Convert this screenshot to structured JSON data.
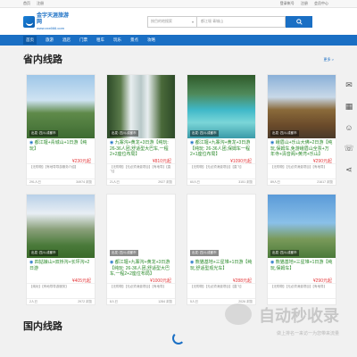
{
  "topbar": {
    "left": [
      "首页",
      "注册"
    ],
    "right": [
      "登录帐号",
      "注册",
      "会员中心"
    ]
  },
  "logo": {
    "title": "金字天涯旅游网",
    "sub": "www.xxx666.com"
  },
  "search": {
    "select": "按目的地搜索",
    "placeholder": "都江堰 青城山",
    "button_icon": "search-icon"
  },
  "nav": [
    "首页",
    "旅游",
    "酒店",
    "门票",
    "租车",
    "玩乐",
    "景点",
    "攻略"
  ],
  "section1": {
    "title": "省内线路",
    "more": "更多 >"
  },
  "section2": {
    "title": "国内线路"
  },
  "cards": [
    {
      "tag": "出发: 四川-成都市",
      "title": "都江堰+青城山+1日游【纯玩】",
      "price": "¥230元起",
      "desc": "【无购物】【有地导导游服务介绍】",
      "foot_left": "291人已",
      "foot_right": "34974 浏览",
      "img": "pagoda"
    },
    {
      "tag": "出发: 四川-成都市",
      "title": "九寨沟+黄龙+3日游【纯玩: 26-36人团,舒适型大巴车,一程2+2座位布局】",
      "price": "¥810元起",
      "desc": "【无购物】【无必须消费项目】【有地导】【直飞】",
      "foot_left": "21人已",
      "foot_right": "2927 浏览",
      "img": "waterfall"
    },
    {
      "tag": "出发: 四川-成都市",
      "title": "都江堰+九寨沟+黄龙+3日游【纯玩: 26-36人团,保姆车一程2+1座位布局】",
      "price": "¥1090元起",
      "desc": "【无购物】【无必须消费项目】【直飞】",
      "foot_left": "60人已",
      "foot_right": "3151 浏览",
      "img": "lake"
    },
    {
      "tag": "出发: 四川-成都市",
      "title": "峨眉山+乐山大佛+2日游【纯玩,保姆车,免游峨眉山全票+万年寺+清音阁+黄湾+乐山】",
      "price": "¥290元起",
      "desc": "【无购物】【无必须消费项目】【有地导】",
      "foot_left": "89人已",
      "foot_right": "21617 浏览",
      "img": "temple"
    },
    {
      "tag": "出发: 四川-成都市",
      "title": "四姑娘山+双桥沟+长坪沟+2日游",
      "price": "¥405元起",
      "desc": "【纯玩】【有地导导游服务】",
      "foot_left": "2人已",
      "foot_right": "2972 浏览",
      "img": "mountain"
    },
    {
      "tag": "出发: 四川-成都市",
      "title": "都江堰+九寨沟+黄龙+3日游【纯玩: 26-36人团,舒适型大巴车,一程2+2座位布局】",
      "price": "¥1000元起",
      "desc": "【无购物】【无必须消费项目】【有地导】",
      "foot_left": "8人已",
      "foot_right": "1284 浏览",
      "img": "blank"
    },
    {
      "tag": "出发: 四川-成都市",
      "title": "熊猫基地+三星堆+1日游【纯玩,舒适型观光车】",
      "price": "¥288元起",
      "desc": "【无购物】【无必须消费项目】【直飞】",
      "foot_left": "5人已",
      "foot_right": "2026 浏览",
      "img": "blank"
    },
    {
      "tag": "出发: 四川-成都市",
      "title": "熊猫基地+三星堆+1日游【纯玩,保姆车】",
      "price": "¥290元起",
      "desc": "【无购物】【无必须消费项目】【有地导】",
      "foot_left": "",
      "foot_right": "",
      "img": "monument"
    }
  ],
  "watermark": {
    "big": "自动秒收录",
    "small": "做上排名一来访一为您带来流量"
  },
  "sidebar_icons": [
    "chat-icon",
    "qr-icon",
    "user-icon",
    "phone-icon",
    "share-icon"
  ]
}
